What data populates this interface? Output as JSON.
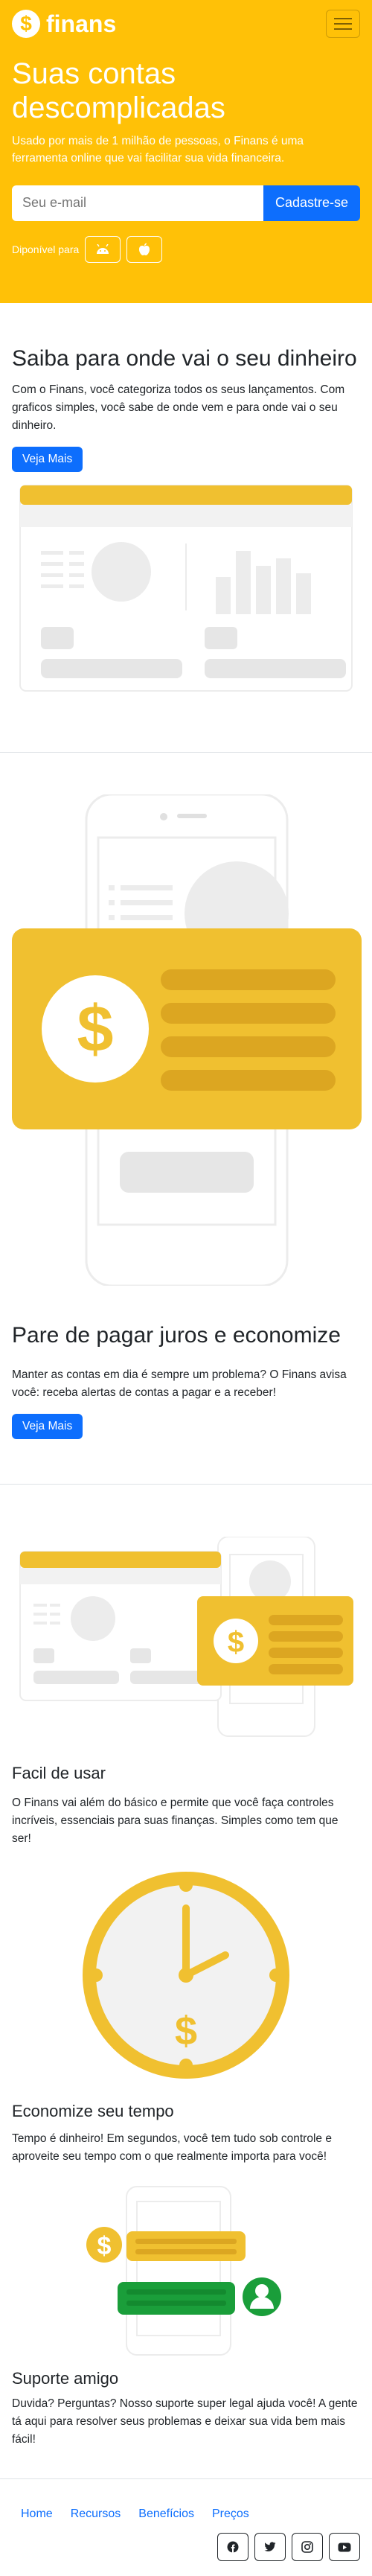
{
  "brand": {
    "name": "finans",
    "logo_symbol": "$"
  },
  "nav": {
    "toggle_icon": "hamburger-icon"
  },
  "hero": {
    "title": "Suas contas descomplicadas",
    "lead": "Usado por mais de 1 milhão de pessoas, o Finans é uma ferramenta online que vai facilitar sua vida financeira.",
    "email_placeholder": "Seu e-mail",
    "signup_label": "Cadastre-se",
    "available_label": "Diponível para",
    "stores": [
      "android-icon",
      "apple-icon"
    ]
  },
  "features": [
    {
      "title": "Saiba para onde vai o seu dinheiro",
      "text": "Com o Finans, você categoriza todos os seus lançamentos. Com graficos simples, você sabe de onde vem e para onde vai o seu dinheiro.",
      "button": "Veja Mais"
    },
    {
      "title": "Pare de pagar juros e economize",
      "text": "Manter as contas em dia é sempre um problema? O Finans avisa você: receba alertas de contas a pagar e a receber!",
      "button": "Veja Mais"
    },
    {
      "title": "Facil de usar",
      "text": "O Finans vai além do básico e permite que você faça controles incríveis, essenciais para suas finanças. Simples como tem que ser!"
    },
    {
      "title": "Economize seu tempo",
      "text": "Tempo é dinheiro! Em segundos, você tem tudo sob controle e aproveite seu tempo com o que realmente importa para você!"
    },
    {
      "title": "Suporte amigo",
      "text": "Duvida? Perguntas? Nosso suporte super legal ajuda você! A gente tá aqui para resolver seus problemas e deixar sua vida bem mais fácil!"
    }
  ],
  "footer": {
    "links": [
      "Home",
      "Recursos",
      "Benefícios",
      "Preços"
    ],
    "social": [
      "facebook-icon",
      "twitter-icon",
      "instagram-icon",
      "youtube-icon"
    ]
  },
  "colors": {
    "accent": "#ffc107",
    "primary": "#0d6efd",
    "illus_yellow": "#f0c030",
    "illus_gray": "#e6e6e6",
    "illus_green": "#1a9e3a"
  }
}
